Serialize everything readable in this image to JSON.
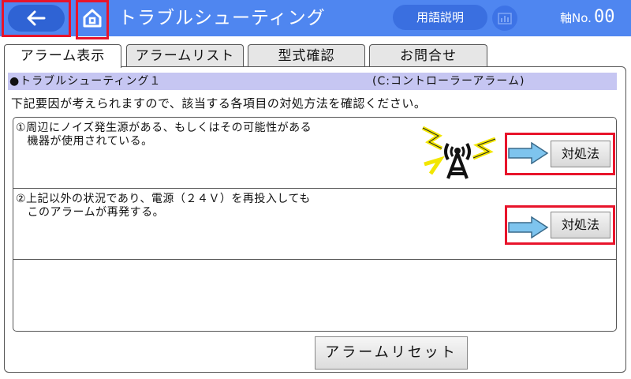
{
  "header": {
    "title": "トラブルシューティング",
    "glossary_label": "用語説明",
    "axis_label": "軸No.",
    "axis_value": "00",
    "icons": {
      "back": "back-arrow-icon",
      "home": "home-icon",
      "monitor": "monitor-icon"
    },
    "colors": {
      "bar": "#4f86f0",
      "highlight": "#e8142b"
    }
  },
  "tabs": [
    {
      "label": "アラーム表示",
      "active": true
    },
    {
      "label": "アラームリスト",
      "active": false
    },
    {
      "label": "型式確認",
      "active": false
    },
    {
      "label": "お問合せ",
      "active": false
    }
  ],
  "section": {
    "title": "●トラブルシューティング１",
    "code": "(C:コントローラーアラーム)"
  },
  "instruction": "下記要因が考えられますので、該当する各項目の対処方法を確認ください。",
  "items": [
    {
      "text": "①周辺にノイズ発生源がある、もしくはその可能性がある\n　機器が使用されている。",
      "icon": "antenna-noise-icon",
      "action_label": "対処法"
    },
    {
      "text": "②上記以外の状況であり、電源（２４Ｖ）を再投入しても\n　このアラームが再発する。",
      "action_label": "対処法"
    }
  ],
  "reset_label": "アラームリセット"
}
